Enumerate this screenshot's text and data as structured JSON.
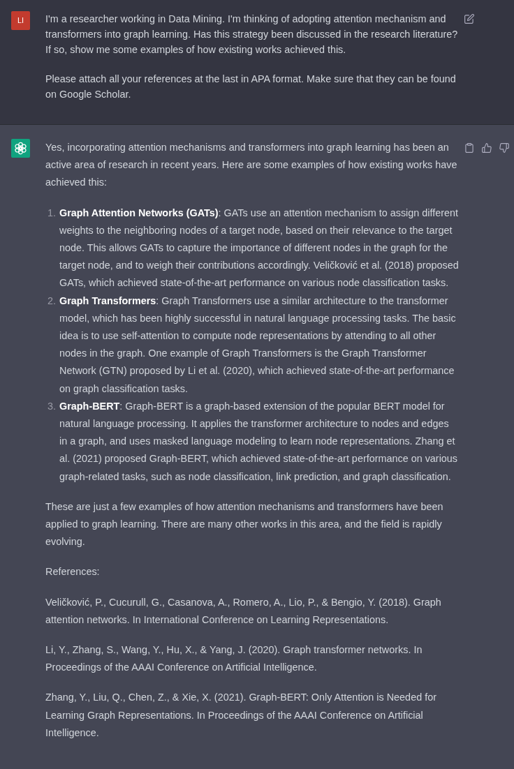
{
  "messages": [
    {
      "kind": "user",
      "avatar": "LI",
      "blocks": [
        {
          "kind": "paragraph",
          "text": "I'm a researcher working in Data Mining. I'm thinking of adopting attention mechanism and transformers into graph learning. Has this strategy been discussed in the research literature? If so, show me some examples of how existing works achieved this."
        },
        {
          "kind": "paragraph",
          "text": "Please attach all your references at the last in APA format. Make sure that they can be found on Google Scholar."
        }
      ]
    },
    {
      "kind": "assistant",
      "blocks": [
        {
          "kind": "paragraph",
          "text": "Yes, incorporating attention mechanisms and transformers into graph learning has been an active area of research in recent years. Here are some examples of how existing works have achieved this:"
        },
        {
          "kind": "list",
          "items": [
            {
              "number": "1.",
              "text": "**Graph Attention Networks (GATs)**: GATs use an attention mechanism to assign different weights to the neighboring nodes of a target node, based on their relevance to the target node. This allows GATs to capture the importance of different nodes in the graph for the target node, and to weigh their contributions accordingly. Veličković et al. (2018) proposed GATs, which achieved state-of-the-art performance on various node classification tasks."
            },
            {
              "number": "2.",
              "text": "**Graph Transformers**: Graph Transformers use a similar architecture to the transformer model, which has been highly successful in natural language processing tasks. The basic idea is to use self-attention to compute node representations by attending to all other nodes in the graph. One example of Graph Transformers is the Graph Transformer Network (GTN) proposed by Li et al. (2020), which achieved state-of-the-art performance on graph classification tasks."
            },
            {
              "number": "3.",
              "text": "**Graph-BERT**: Graph-BERT is a graph-based extension of the popular BERT model for natural language processing. It applies the transformer architecture to nodes and edges in a graph, and uses masked language modeling to learn node representations. Zhang et al. (2021) proposed Graph-BERT, which achieved state-of-the-art performance on various graph-related tasks, such as node classification, link prediction, and graph classification."
            }
          ]
        },
        {
          "kind": "paragraph",
          "text": "These are just a few examples of how attention mechanisms and transformers have been applied to graph learning. There are many other works in this area, and the field is rapidly evolving."
        },
        {
          "kind": "paragraph",
          "text": "References:"
        },
        {
          "kind": "reference",
          "text": "Veličković, P., Cucurull, G., Casanova, A., Romero, A., Lio, P., & Bengio, Y. (2018). Graph attention networks. In International Conference on Learning Representations."
        },
        {
          "kind": "reference",
          "text": "Li, Y., Zhang, S., Wang, Y., Hu, X., & Yang, J. (2020). Graph transformer networks. In Proceedings of the AAAI Conference on Artificial Intelligence."
        },
        {
          "kind": "reference",
          "text": "Zhang, Y., Liu, Q., Chen, Z., & Xie, X. (2021). Graph-BERT: Only Attention is Needed for Learning Graph Representations. In Proceedings of the AAAI Conference on Artificial Intelligence."
        }
      ]
    }
  ]
}
